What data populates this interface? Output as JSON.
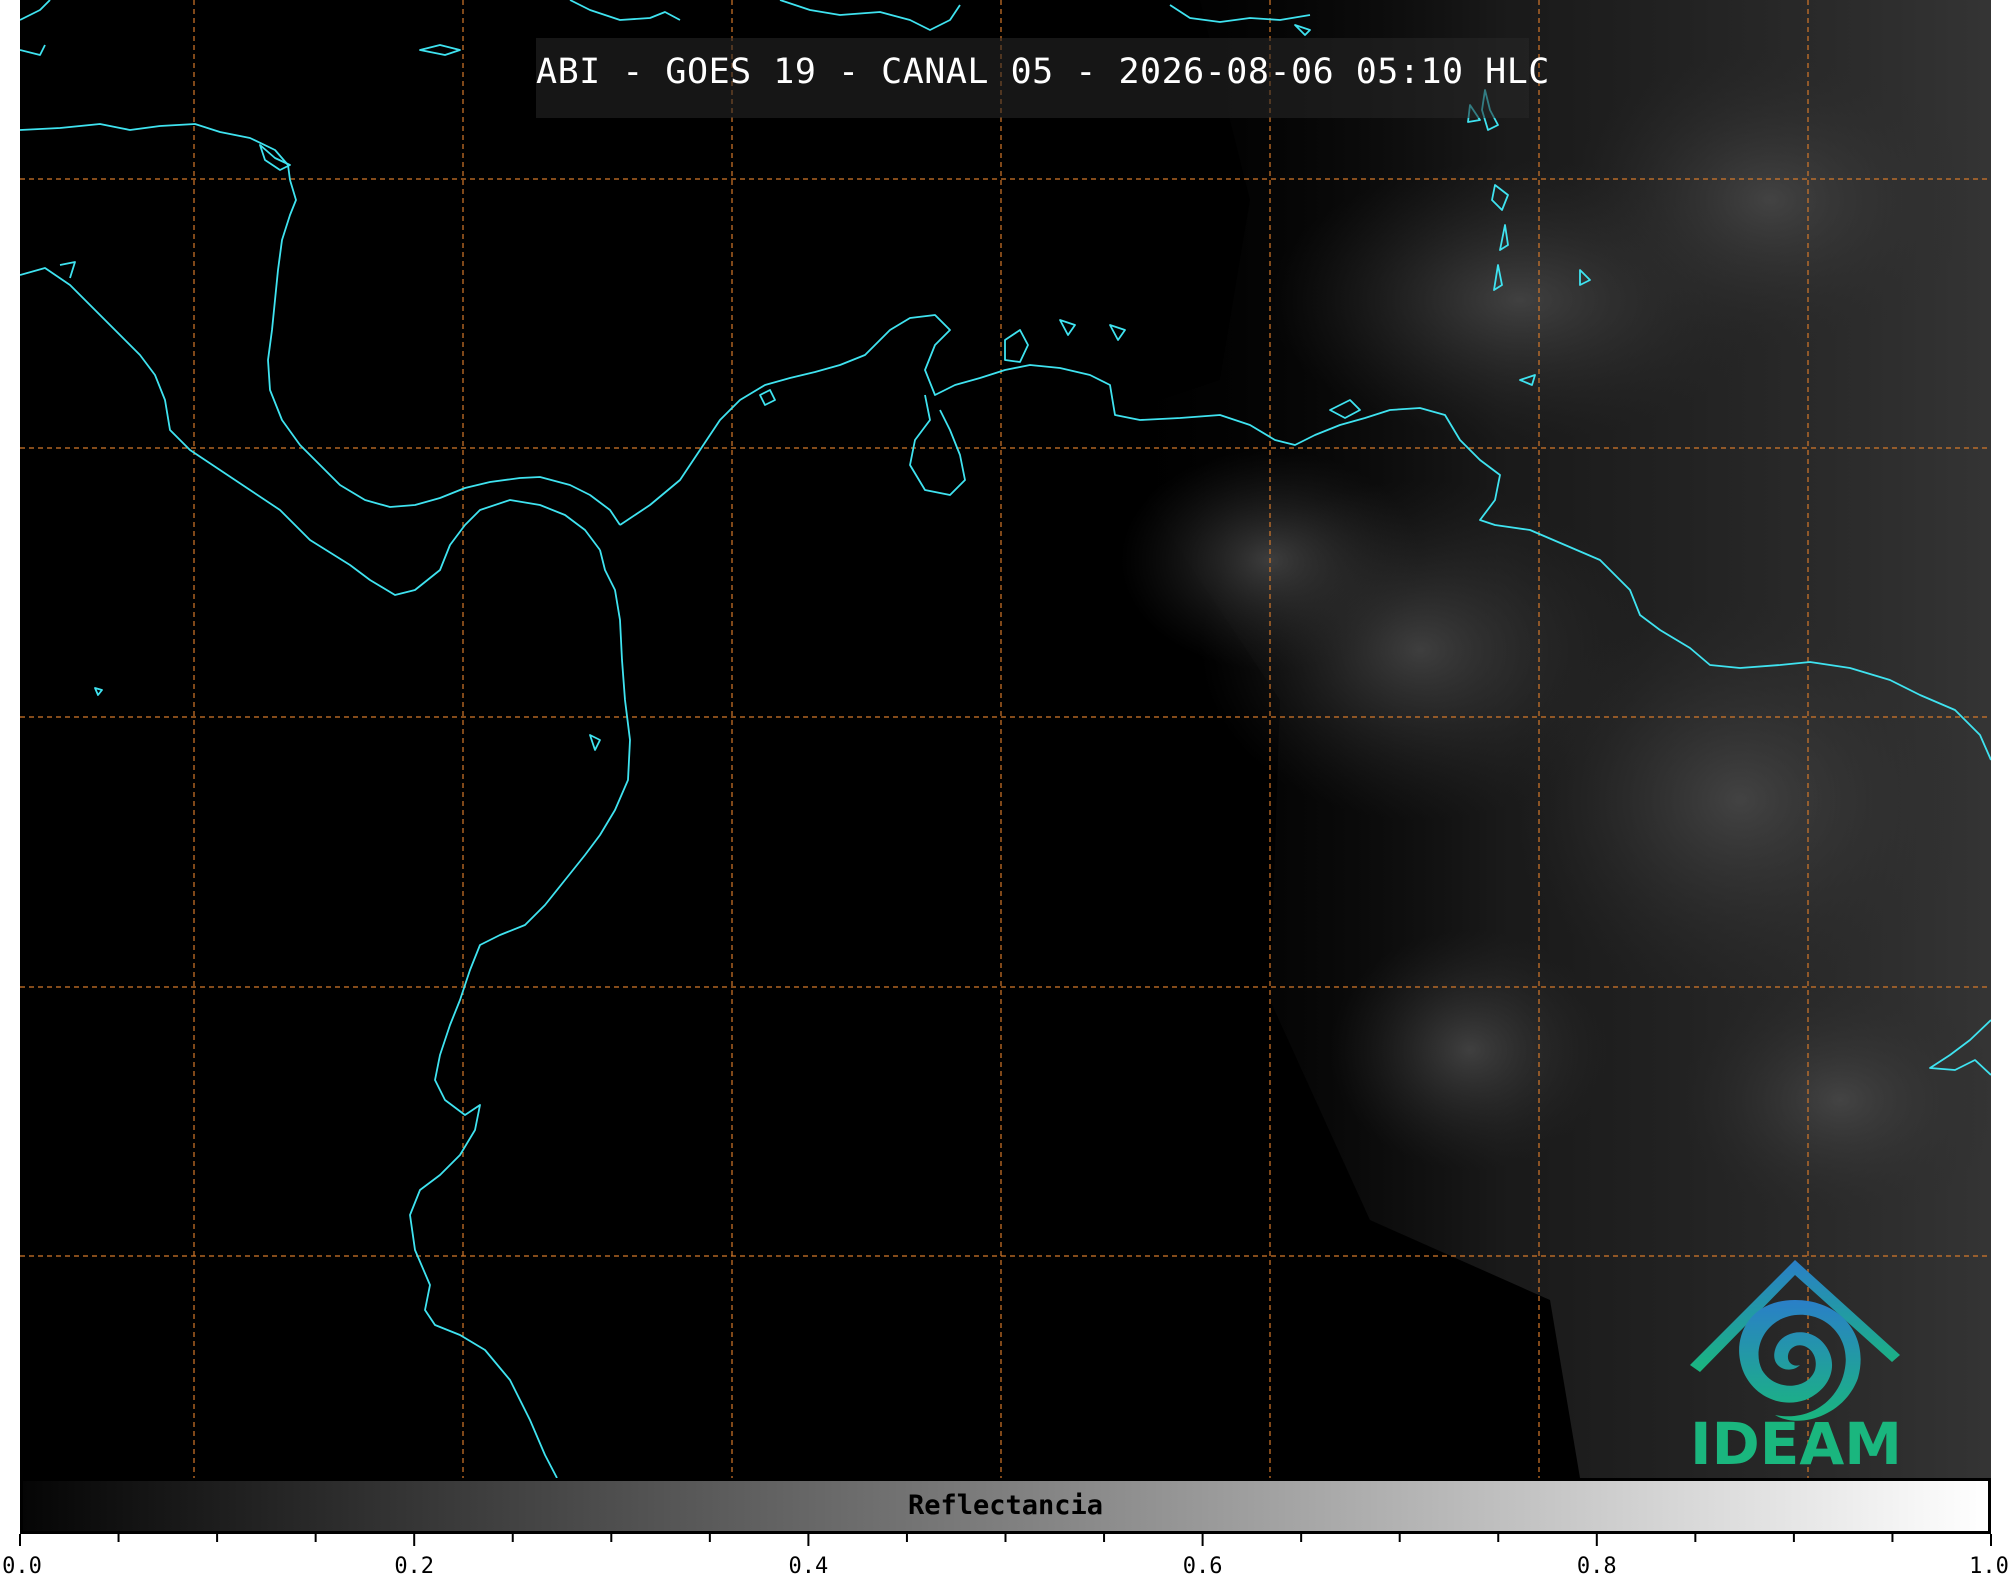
{
  "title": "ABI - GOES 19 - CANAL 05 - 2026-08-06 05:10 HLC",
  "colorbar": {
    "label": "Reflectancia",
    "range": [
      0.0,
      1.0
    ],
    "major_ticks": [
      "0.0",
      "0.2",
      "0.4",
      "0.6",
      "0.8",
      "1.0"
    ],
    "gradient": [
      "#000000",
      "#ffffff"
    ]
  },
  "logo": {
    "text": "IDEAM",
    "text_color": "#1ab67e",
    "icon": "ideam-logo-icon"
  },
  "colors": {
    "coastline": "#3fe3f0",
    "gridline": "#d4782a",
    "background": "#000000",
    "title_text": "#ffffff"
  },
  "map": {
    "gridlines": "dashed",
    "graticule_columns": 7,
    "graticule_rows": 5
  }
}
